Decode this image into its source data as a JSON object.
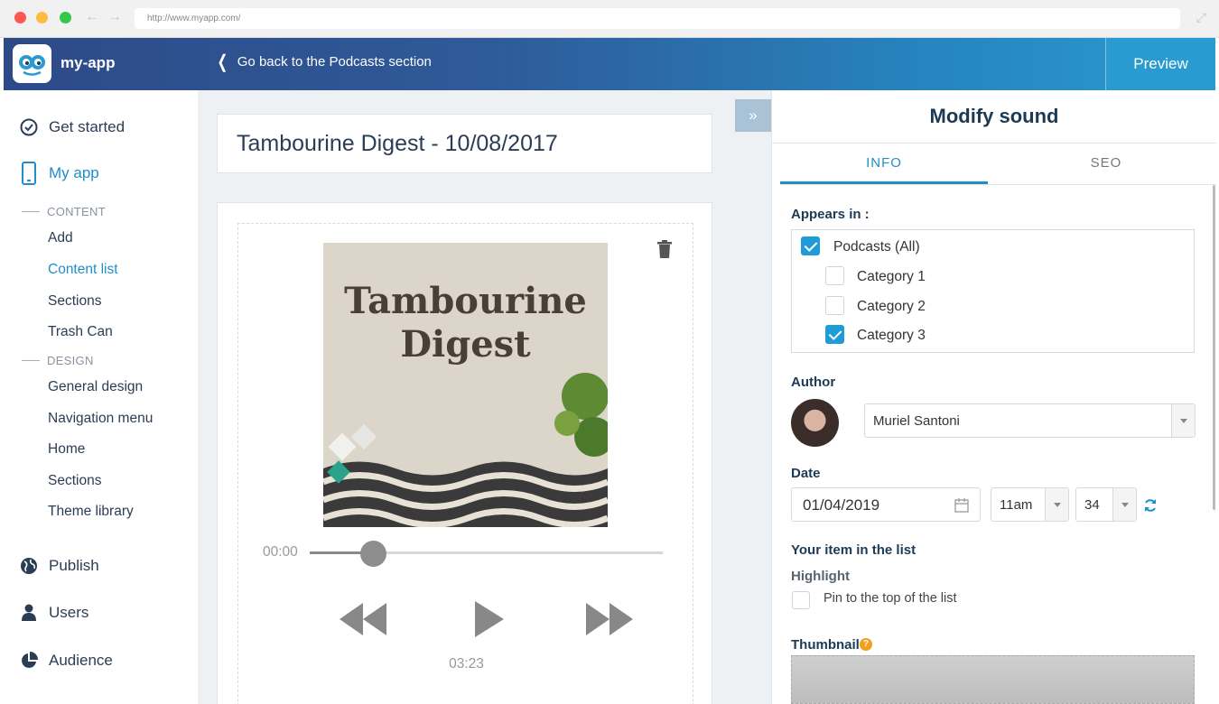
{
  "browser": {
    "url": "http://www.myapp.com/"
  },
  "header": {
    "app_name": "my-app",
    "back_link": "Go back to the Podcasts section",
    "preview_label": "Preview"
  },
  "sidebar": {
    "get_started": "Get started",
    "my_app": "My app",
    "content_section": "CONTENT",
    "content_items": [
      "Add",
      "Content list",
      "Sections",
      "Trash Can"
    ],
    "design_section": "DESIGN",
    "design_items": [
      "General design",
      "Navigation menu",
      "Home",
      "Sections",
      "Theme library"
    ],
    "publish": "Publish",
    "users": "Users",
    "audience": "Audience"
  },
  "main": {
    "title": "Tambourine Digest - 10/08/2017",
    "cover_title_line1": "Tambourine",
    "cover_title_line2": "Digest",
    "current_time": "00:00",
    "total_time": "03:23",
    "progress": 0.18
  },
  "panel": {
    "title": "Modify sound",
    "tabs": [
      "INFO",
      "SEO"
    ],
    "active_tab": "INFO",
    "appears_in_label": "Appears in :",
    "categories": [
      {
        "label": "Podcasts (All)",
        "checked": true
      },
      {
        "label": "Category 1",
        "checked": false
      },
      {
        "label": "Category 2",
        "checked": false
      },
      {
        "label": "Category 3",
        "checked": true
      }
    ],
    "author_label": "Author",
    "author_value": "Muriel Santoni",
    "date_label": "Date",
    "date_value": "01/04/2019",
    "hour_value": "11am",
    "minute_value": "34",
    "list_item_label": "Your item in the list",
    "highlight_label": "Highlight",
    "pin_label": "Pin to the top of the list",
    "pin_checked": false,
    "thumbnail_label": "Thumbnail",
    "help_glyph": "?"
  },
  "colors": {
    "accent": "#1f8ec9",
    "checkbox": "#1f9bd8",
    "header_start": "#2d4a87",
    "header_end": "#2a9bd0"
  }
}
